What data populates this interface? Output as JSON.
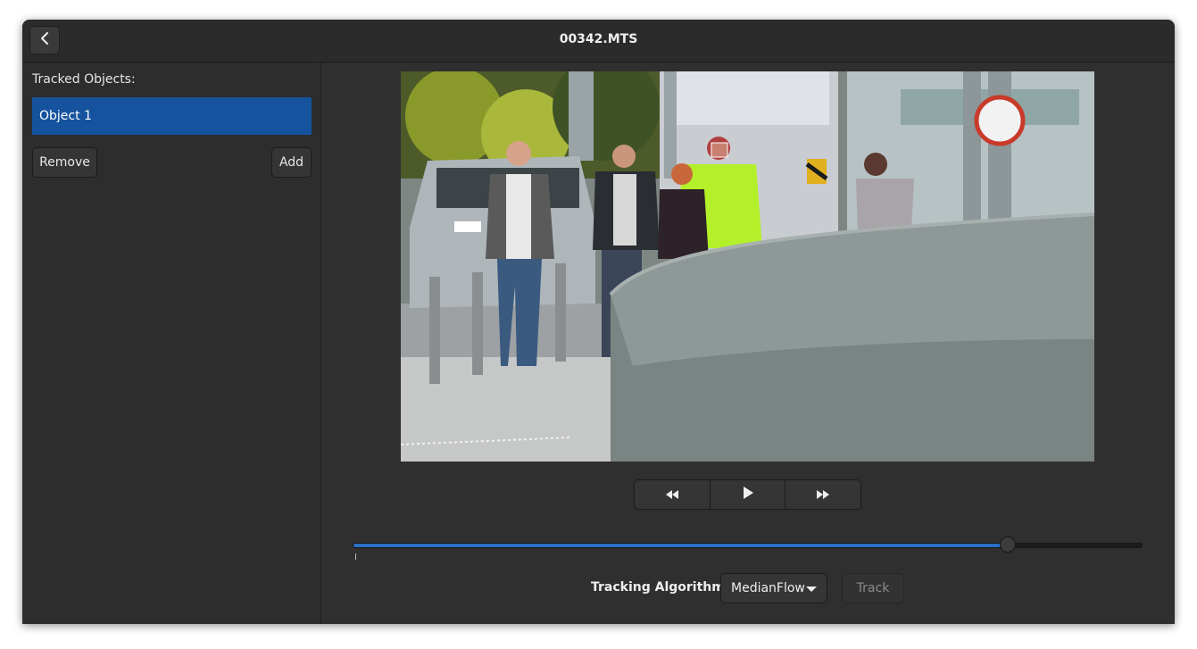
{
  "window": {
    "title": "00342.MTS",
    "back_icon": "chevron-left-icon"
  },
  "sidebar": {
    "heading": "Tracked Objects:",
    "objects": [
      {
        "label": "Object 1",
        "selected": true
      }
    ],
    "remove_label": "Remove",
    "add_label": "Add"
  },
  "player": {
    "rewind_icon": "rewind-icon",
    "play_icon": "play-icon",
    "forward_icon": "fast-forward-icon",
    "progress": 0.83
  },
  "tracking": {
    "label": "Tracking Algorithm",
    "algorithm": "MedianFlow",
    "track_label": "Track",
    "track_enabled": false
  },
  "colors": {
    "accent": "#15539e",
    "slider_fill": "#2a6fc4",
    "window_bg": "#2d2d2d"
  }
}
